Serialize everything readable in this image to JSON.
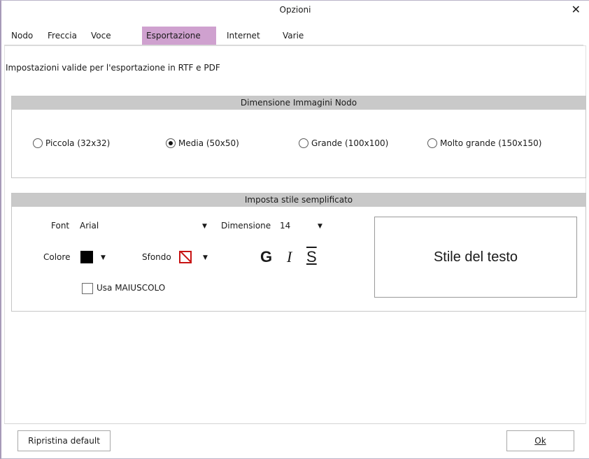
{
  "window": {
    "title": "Opzioni"
  },
  "tabs": [
    {
      "label": "Nodo",
      "active": false
    },
    {
      "label": "Freccia",
      "active": false
    },
    {
      "label": "Voce",
      "active": false
    },
    {
      "label": "Esportazione",
      "active": true
    },
    {
      "label": "Internet",
      "active": false
    },
    {
      "label": "Varie",
      "active": false
    }
  ],
  "export": {
    "description": "Impostazioni valide per l'esportazione in RTF e PDF",
    "image_size": {
      "header": "Dimensione Immagini Nodo",
      "options": [
        {
          "label": "Piccola (32x32)",
          "selected": false
        },
        {
          "label": "Media (50x50)",
          "selected": true
        },
        {
          "label": "Grande (100x100)",
          "selected": false
        },
        {
          "label": "Molto grande (150x150)",
          "selected": false
        }
      ]
    },
    "style": {
      "header": "Imposta stile semplificato",
      "font_label": "Font",
      "font_value": "Arial",
      "size_label": "Dimensione",
      "size_value": "14",
      "color_label": "Colore",
      "color_value": "#000000",
      "background_label": "Sfondo",
      "bold_glyph": "G",
      "italic_glyph": "I",
      "strike_glyph": "S",
      "uppercase_label": "Usa MAIUSCOLO",
      "uppercase_checked": false,
      "preview_text": "Stile del testo"
    }
  },
  "footer": {
    "reset_label": "Ripristina default",
    "ok_label": "Ok"
  },
  "colors": {
    "active_tab": "#cfa1cf",
    "group_header": "#c9c9c9"
  }
}
